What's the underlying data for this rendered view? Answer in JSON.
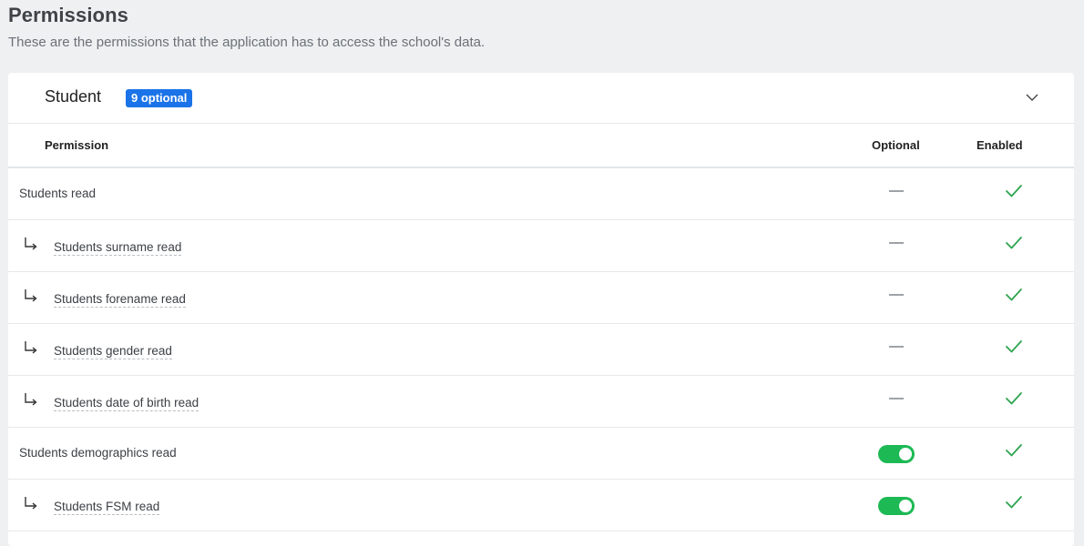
{
  "page": {
    "title": "Permissions",
    "subtitle": "These are the permissions that the application has to access the school's data."
  },
  "section": {
    "title": "Student",
    "badge": "9 optional",
    "expand_icon": "chevron-down-icon"
  },
  "table": {
    "headers": {
      "permission": "Permission",
      "optional": "Optional",
      "enabled": "Enabled"
    },
    "rows": [
      {
        "label": "Students read",
        "level": "parent",
        "optional": "no",
        "enabled": true
      },
      {
        "label": "Students surname read",
        "level": "child",
        "optional": "no",
        "enabled": true
      },
      {
        "label": "Students forename read",
        "level": "child",
        "optional": "no",
        "enabled": true
      },
      {
        "label": "Students gender read",
        "level": "child",
        "optional": "no",
        "enabled": true
      },
      {
        "label": "Students date of birth read",
        "level": "child",
        "optional": "no",
        "enabled": true
      },
      {
        "label": "Students demographics read",
        "level": "parent",
        "optional": "toggle-on",
        "enabled": true
      },
      {
        "label": "Students FSM read",
        "level": "child",
        "optional": "toggle-on",
        "enabled": true
      }
    ]
  },
  "colors": {
    "badge": "#1a73e8",
    "toggle_on": "#1db954",
    "check": "#2ea44f"
  }
}
